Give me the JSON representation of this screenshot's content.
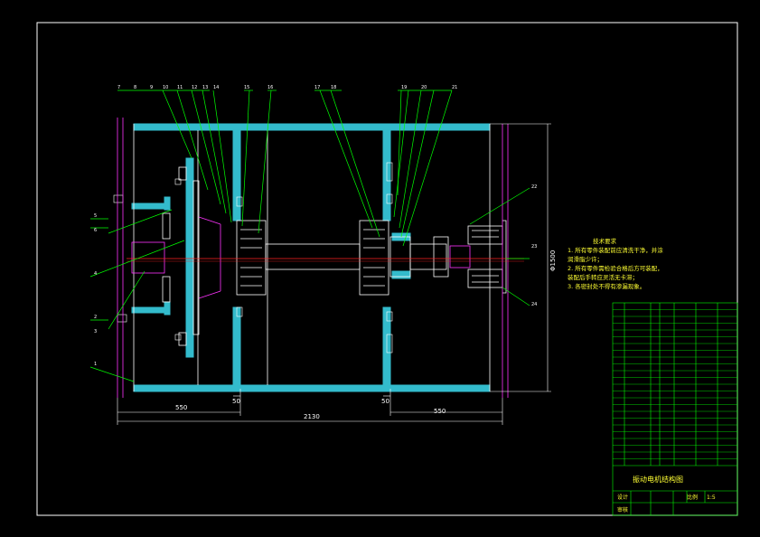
{
  "drawing": {
    "colors": {
      "background": "#000000",
      "frame": "#ffffff",
      "hatch": "#33bbcc",
      "part_outline": "#ffffff",
      "centerline": "#ff2222",
      "leader": "#00ff00",
      "magenta": "#ff33ff",
      "notes_text": "#ffff33",
      "table_lines": "#00ff00"
    },
    "dimensions": {
      "left": "550",
      "right": "550",
      "total": "2130",
      "gap_left": "50",
      "gap_right": "50",
      "height": "Φ1500"
    },
    "callouts": {
      "top": [
        "7",
        "8",
        "9",
        "10",
        "11",
        "12",
        "13",
        "14",
        "15",
        "16",
        "17",
        "18",
        "19",
        "20",
        "21"
      ],
      "left": [
        "5",
        "6",
        "4",
        "2",
        "3",
        "1"
      ],
      "right": [
        "22",
        "23",
        "24"
      ]
    }
  },
  "notes": {
    "title": "技术要求",
    "lines": [
      "1. 所有零件装配前应清洗干净，并涂",
      "润滑脂少许；",
      "2. 所有零件需检验合格后方可装配，",
      "装配后手转应灵活无卡滞；",
      "3. 各密封处不得有渗漏现象。"
    ]
  },
  "title_block": {
    "drawing_title": "振动电机结构图",
    "scale_label": "比例",
    "scale_value": "1:5",
    "design_label": "设计",
    "check_label": "审核"
  }
}
